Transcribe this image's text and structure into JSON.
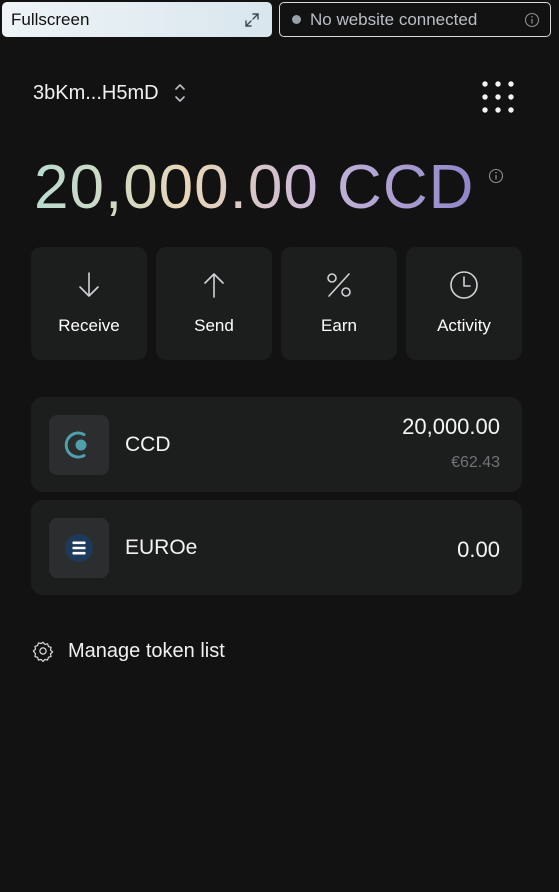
{
  "header": {
    "fullscreen_label": "Fullscreen",
    "connection_status": "No website connected"
  },
  "account": {
    "address": "3bKm...H5mD"
  },
  "balance": {
    "amount": "20,000.00 CCD"
  },
  "actions": [
    {
      "label": "Receive",
      "icon": "arrow-down-icon"
    },
    {
      "label": "Send",
      "icon": "arrow-up-icon"
    },
    {
      "label": "Earn",
      "icon": "percent-icon"
    },
    {
      "label": "Activity",
      "icon": "clock-icon"
    }
  ],
  "tokens": [
    {
      "name": "CCD",
      "amount": "20,000.00",
      "fiat": "€62.43",
      "icon": "ccd-logo-icon"
    },
    {
      "name": "EUROe",
      "amount": "0.00",
      "icon": "euroe-logo-icon"
    }
  ],
  "manage": {
    "label": "Manage token list",
    "icon": "gear-icon"
  },
  "colors": {
    "background": "#121212",
    "card": "#1c1d1d",
    "ccd_accent": "#4fa0ad"
  }
}
